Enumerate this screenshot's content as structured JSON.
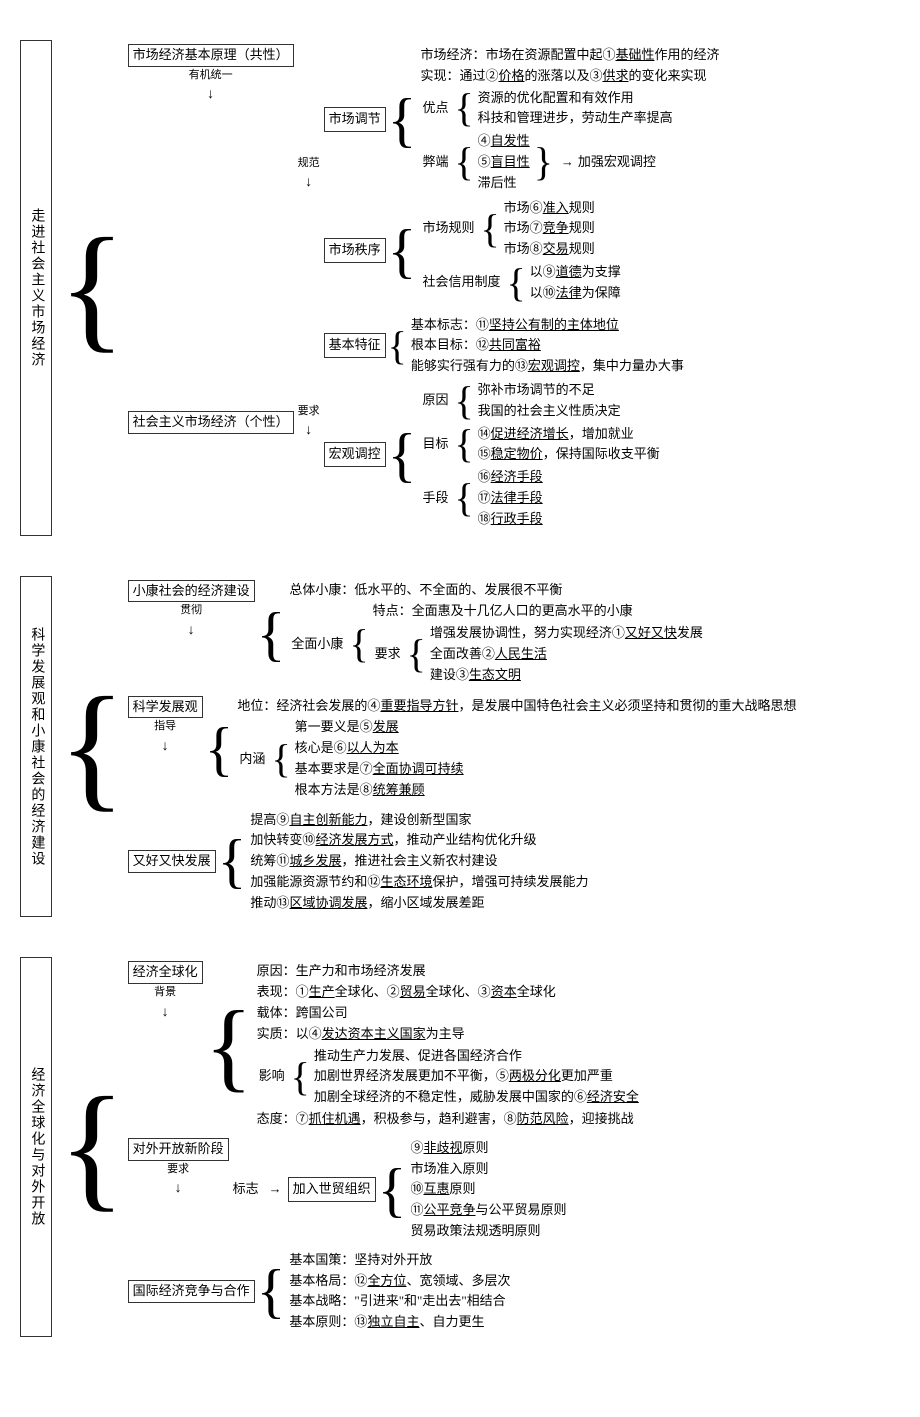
{
  "diagram1": {
    "root": "走进社会主义市场经济",
    "branches": [
      {
        "label": "市场经济基本原理（共性）",
        "connector1": "有机统一",
        "connector2": "规范",
        "sub": [
          {
            "label": "市场调节",
            "items": [
              "市场经济：市场在资源配置中起①基础性作用的经济",
              "实现：通过②价格的涨落以及③供求的变化来实现"
            ],
            "advantages_label": "优点",
            "advantages": [
              "资源的优化配置和有效作用",
              "科技和管理进步，劳动生产率提高"
            ],
            "disadvantages_label": "弊端",
            "disadvantages": [
              "④自发性",
              "⑤盲目性",
              "滞后性"
            ],
            "disadvantage_note": "加强宏观调控"
          },
          {
            "label": "市场秩序",
            "rules_label": "市场规则",
            "rules": [
              "市场⑥准入规则",
              "市场⑦竞争规则",
              "市场⑧交易规则"
            ],
            "credit_label": "社会信用制度",
            "credit": [
              "以⑨道德为支撑",
              "以⑩法律为保障"
            ]
          }
        ]
      },
      {
        "label": "社会主义市场经济（个性）",
        "connector": "要求",
        "sub": [
          {
            "label": "基本特征",
            "items": [
              "基本标志：⑪坚持公有制的主体地位",
              "根本目标：⑫共同富裕",
              "能够实行强有力的⑬宏观调控，集中力量办大事"
            ]
          },
          {
            "label": "宏观调控",
            "reason_label": "原因",
            "reasons": [
              "弥补市场调节的不足",
              "我国的社会主义性质决定"
            ],
            "goal_label": "目标",
            "goals": [
              "⑭促进经济增长，增加就业",
              "⑮稳定物价，保持国际收支平衡"
            ],
            "means_label": "手段",
            "means": [
              "⑯经济手段",
              "⑰法律手段",
              "⑱行政手段"
            ]
          }
        ]
      }
    ]
  },
  "diagram2": {
    "root": "科学发展观和小康社会的经济建设",
    "branches": [
      {
        "label": "小康社会的经济建设",
        "connector": "贯彻",
        "overall": "总体小康：低水平的、不全面的、发展很不平衡",
        "full_label": "全面小康",
        "feature": "特点：全面惠及十几亿人口的更高水平的小康",
        "req_label": "要求",
        "requirements": [
          "增强发展协调性，努力实现经济①又好又快发展",
          "全面改善②人民生活",
          "建设③生态文明"
        ]
      },
      {
        "label": "科学发展观",
        "connector": "指导",
        "position": "地位：经济社会发展的④重要指导方针，是发展中国特色社会主义必须坚持和贯彻的重大战略思想",
        "content_label": "内涵",
        "content": [
          "第一要义是⑤发展",
          "核心是⑥以人为本",
          "基本要求是⑦全面协调可持续",
          "根本方法是⑧统筹兼顾"
        ]
      },
      {
        "label": "又好又快发展",
        "items": [
          "提高⑨自主创新能力，建设创新型国家",
          "加快转变⑩经济发展方式，推动产业结构优化升级",
          "统筹⑪城乡发展，推进社会主义新农村建设",
          "加强能源资源节约和⑫生态环境保护，增强可持续发展能力",
          "推动⑬区域协调发展，缩小区域发展差距"
        ]
      }
    ]
  },
  "diagram3": {
    "root": "经济全球化与对外开放",
    "branches": [
      {
        "label": "经济全球化",
        "connector": "背景",
        "cause": "原因：生产力和市场经济发展",
        "manifest": "表现：①生产全球化、②贸易全球化、③资本全球化",
        "carrier": "载体：跨国公司",
        "essence": "实质：以④发达资本主义国家为主导",
        "impact_label": "影响",
        "impacts": [
          "推动生产力发展、促进各国经济合作",
          "加剧世界经济发展更加不平衡，⑤两极分化更加严重",
          "加剧全球经济的不稳定性，威胁发展中国家的⑥经济安全"
        ],
        "attitude": "态度：⑦抓住机遇，积极参与，趋利避害，⑧防范风险，迎接挑战"
      },
      {
        "label": "对外开放新阶段",
        "mark_label": "标志",
        "wto": "加入世贸组织",
        "connector": "要求",
        "principles": [
          "⑨非歧视原则",
          "市场准入原则",
          "⑩互惠原则",
          "⑪公平竞争与公平贸易原则",
          "贸易政策法规透明原则"
        ]
      },
      {
        "label": "国际经济竞争与合作",
        "items": [
          "基本国策：坚持对外开放",
          "基本格局：⑫全方位、宽领域、多层次",
          "基本战略：\"引进来\"和\"走出去\"相结合",
          "基本原则：⑬独立自主、自力更生"
        ]
      }
    ]
  }
}
